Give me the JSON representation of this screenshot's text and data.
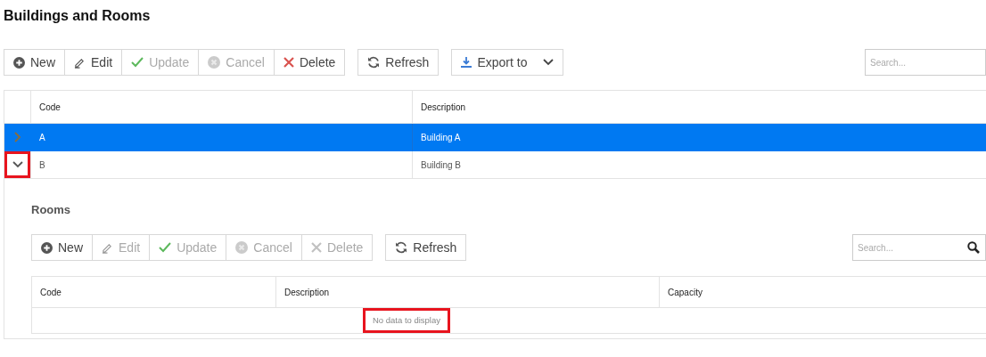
{
  "title": "Buildings and Rooms",
  "toolbar": {
    "groups": [
      [
        {
          "kind": "new",
          "label": "New",
          "disabled": false
        },
        {
          "kind": "edit",
          "label": "Edit",
          "disabled": false
        },
        {
          "kind": "update",
          "label": "Update",
          "disabled": true
        },
        {
          "kind": "cancel",
          "label": "Cancel",
          "disabled": true
        },
        {
          "kind": "delete",
          "label": "Delete",
          "disabled": false
        }
      ],
      [
        {
          "kind": "refresh",
          "label": "Refresh",
          "disabled": false
        }
      ],
      [
        {
          "kind": "export",
          "label": "Export to",
          "disabled": false
        }
      ]
    ],
    "search": {
      "placeholder": "Search..."
    }
  },
  "table": {
    "columns": [
      "Code",
      "Description"
    ],
    "rows": [
      {
        "cells": [
          "A",
          "Building A"
        ],
        "selected": true,
        "expanded": false,
        "highlighted": false
      },
      {
        "cells": [
          "B",
          "Building B"
        ],
        "selected": false,
        "expanded": true,
        "highlighted": true
      }
    ]
  },
  "detail": {
    "title": "Rooms",
    "toolbar": {
      "groups": [
        [
          {
            "kind": "new",
            "label": "New",
            "disabled": false
          },
          {
            "kind": "edit",
            "label": "Edit",
            "disabled": true
          },
          {
            "kind": "update",
            "label": "Update",
            "disabled": true
          },
          {
            "kind": "cancel",
            "label": "Cancel",
            "disabled": true
          },
          {
            "kind": "delete",
            "label": "Delete",
            "disabled": true
          }
        ],
        [
          {
            "kind": "refresh",
            "label": "Refresh",
            "disabled": false
          }
        ]
      ],
      "search": {
        "placeholder": "Search..."
      }
    },
    "table": {
      "columns": [
        "Code",
        "Description",
        "Capacity"
      ],
      "empty_text": "No data to display",
      "empty_highlighted": true
    }
  }
}
